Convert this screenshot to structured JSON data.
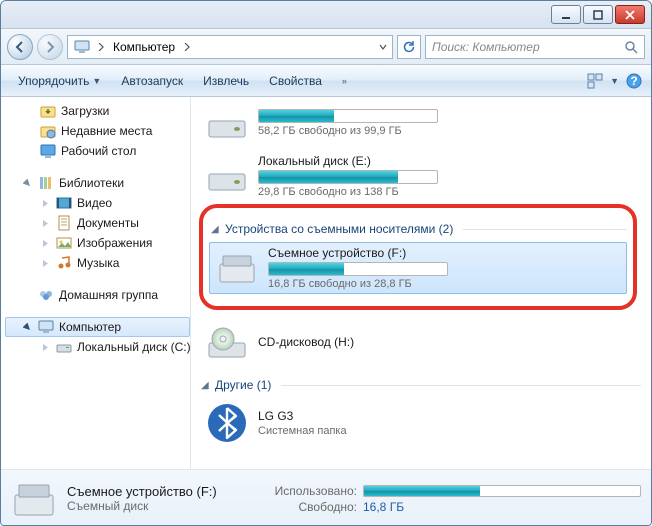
{
  "address": {
    "root_label": "Компьютер"
  },
  "search": {
    "placeholder": "Поиск: Компьютер"
  },
  "toolbar": {
    "organize": "Упорядочить",
    "autoplay": "Автозапуск",
    "eject": "Извлечь",
    "properties": "Свойства"
  },
  "sidebar": {
    "downloads": "Загрузки",
    "recent": "Недавние места",
    "desktop": "Рабочий стол",
    "libraries": "Библиотеки",
    "videos": "Видео",
    "documents": "Документы",
    "pictures": "Изображения",
    "music": "Музыка",
    "homegroup": "Домашняя группа",
    "computer": "Компьютер",
    "local_c": "Локальный диск (C:)"
  },
  "content": {
    "drive_partial_sub": "58,2 ГБ свободно из 99,9 ГБ",
    "drive_e": {
      "title": "Локальный диск (E:)",
      "sub": "29,8 ГБ свободно из 138 ГБ",
      "fill": 78
    },
    "group_removable": "Устройства со съемными носителями (2)",
    "drive_f": {
      "title": "Съемное устройство (F:)",
      "sub": "16,8 ГБ свободно из 28,8 ГБ",
      "fill": 42
    },
    "drive_cd": {
      "title": "CD-дисковод (H:)"
    },
    "group_other": "Другие (1)",
    "lg": {
      "title": "LG G3",
      "sub": "Системная папка"
    }
  },
  "details": {
    "title": "Съемное устройство (F:)",
    "subtitle": "Съемный диск",
    "used_label": "Использовано:",
    "free_label": "Свободно:",
    "free_value": "16,8 ГБ",
    "fill": 42
  }
}
